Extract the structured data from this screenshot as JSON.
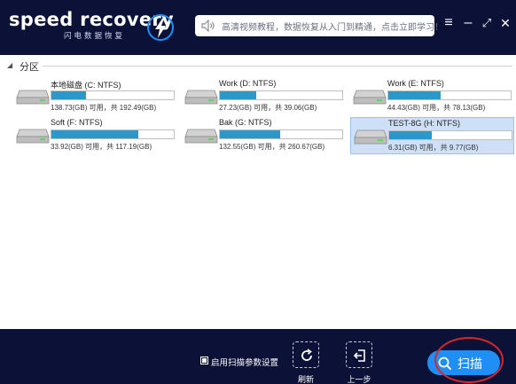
{
  "app": {
    "logo_text": "speed recovery",
    "logo_subtitle": "闪电数据恢复"
  },
  "notice": {
    "text": "高清视频教程，数据恢复从入门到精通，点击立即学习！",
    "icon": "speaker-icon"
  },
  "window_controls": {
    "menu": "≡",
    "minimize": "–",
    "restore": "⤢",
    "close": "✕"
  },
  "partition_section": {
    "title": "分区"
  },
  "drives": [
    {
      "label": "本地磁盘 (C: NTFS)",
      "usage": "138.73(GB) 可用，共 192.49(GB)",
      "used_fraction": 0.28,
      "selected": false
    },
    {
      "label": "Work (D: NTFS)",
      "usage": "27.23(GB) 可用，共 39.06(GB)",
      "used_fraction": 0.3,
      "selected": false
    },
    {
      "label": "Work (E: NTFS)",
      "usage": "44.43(GB) 可用，共 78.13(GB)",
      "used_fraction": 0.43,
      "selected": false
    },
    {
      "label": "Soft (F: NTFS)",
      "usage": "33.92(GB) 可用，共 117.19(GB)",
      "used_fraction": 0.71,
      "selected": false
    },
    {
      "label": "Bak (G: NTFS)",
      "usage": "132.55(GB) 可用，共 260.67(GB)",
      "used_fraction": 0.49,
      "selected": false
    },
    {
      "label": "TEST-8G (H: NTFS)",
      "usage": "6.31(GB) 可用，共 9.77(GB)",
      "used_fraction": 0.35,
      "selected": true
    }
  ],
  "footer": {
    "scan_settings_label": "启用扫描参数设置",
    "scan_settings_checked": true,
    "refresh_label": "刷新",
    "back_label": "上一步",
    "scan_label": "扫描"
  },
  "colors": {
    "header_bg": "#0c1138",
    "accent": "#1f8ff5",
    "bar_fill": "#2b98c9",
    "selected_bg": "#cde0f7",
    "highlight_ring": "#d9262b"
  }
}
